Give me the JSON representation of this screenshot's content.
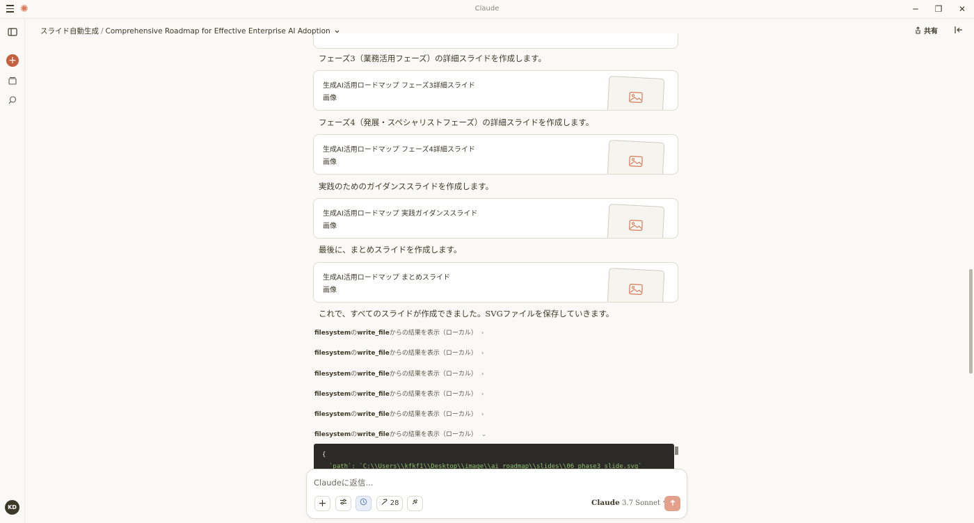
{
  "window": {
    "title": "Claude",
    "controls": [
      "─",
      "❐",
      "✕"
    ]
  },
  "header": {
    "project": "スライド自動生成",
    "separator": "/",
    "chat_title": "Comprehensive Roadmap for Effective Enterprise AI Adoption",
    "share_label": "共有"
  },
  "user": {
    "initials": "KD"
  },
  "messages": [
    {
      "text": "フェーズ3（業務活用フェーズ）の詳細スライドを作成します。",
      "card_title": "生成AI活用ロードマップ フェーズ3詳細スライド",
      "card_sub": "画像"
    },
    {
      "text": "フェーズ4（発展・スペシャリストフェーズ）の詳細スライドを作成します。",
      "card_title": "生成AI活用ロードマップ フェーズ4詳細スライド",
      "card_sub": "画像"
    },
    {
      "text": "実践のためのガイダンススライドを作成します。",
      "card_title": "生成AI活用ロードマップ 実践ガイダンススライド",
      "card_sub": "画像"
    },
    {
      "text": "最後に、まとめスライドを作成します。",
      "card_title": "生成AI活用ロードマップ まとめスライド",
      "card_sub": "画像"
    }
  ],
  "final_text": "これで、すべてのスライドが作成できました。SVGファイルを保存していきます。",
  "tool_results": [
    {
      "tool": "filesystem",
      "conn": "の",
      "fn": "write_file",
      "rest": "からの結果を表示（ローカル）",
      "chevron": "›"
    },
    {
      "tool": "filesystem",
      "conn": "の",
      "fn": "write_file",
      "rest": "からの結果を表示（ローカル）",
      "chevron": "›"
    },
    {
      "tool": "filesystem",
      "conn": "の",
      "fn": "write_file",
      "rest": "からの結果を表示（ローカル）",
      "chevron": "›"
    },
    {
      "tool": "filesystem",
      "conn": "の",
      "fn": "write_file",
      "rest": "からの結果を表示（ローカル）",
      "chevron": "›"
    },
    {
      "tool": "filesystem",
      "conn": "の",
      "fn": "write_file",
      "rest": "からの結果を表示（ローカル）",
      "chevron": "›"
    },
    {
      "tool": "filesystem",
      "conn": "の",
      "fn": "write_file",
      "rest": "からの結果を表示（ローカル）",
      "chevron": "⌄"
    }
  ],
  "code": {
    "line1": "{",
    "line2": "`path`: `C:\\\\Users\\\\kfkf1\\\\Desktop\\\\image\\\\ai_roadmap\\\\slides\\\\06_phase3_slide.svg`"
  },
  "composer": {
    "placeholder": "Claudeに返信...",
    "tools_count": "28",
    "model_name": "Claude",
    "model_version": "3.7 Sonnet"
  },
  "colors": {
    "accent": "#c6613f",
    "background": "#faf9f5",
    "send_button": "#e3a08a"
  }
}
